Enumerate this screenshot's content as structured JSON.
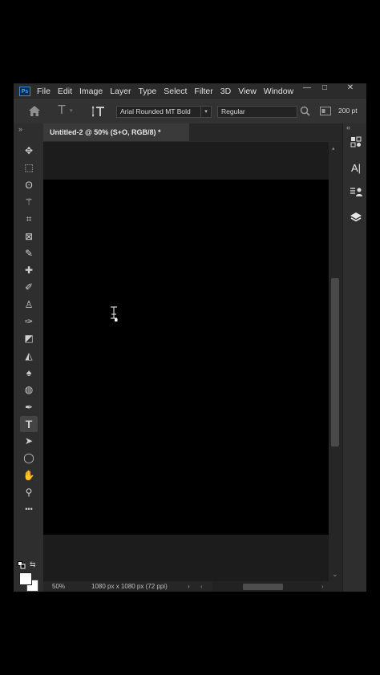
{
  "app": {
    "logo_text": "Ps"
  },
  "menu": [
    "File",
    "Edit",
    "Image",
    "Layer",
    "Type",
    "Select",
    "Filter",
    "3D",
    "View",
    "Window"
  ],
  "window_controls": {
    "minimize": "—",
    "maximize": "□",
    "close": "✕"
  },
  "options_bar": {
    "font_family": "Arial Rounded MT Bold",
    "font_style": "Regular",
    "font_size": "200 pt"
  },
  "document_tab": {
    "title": "Untitled-2 @ 50% (S+O, RGB/8) *"
  },
  "status_bar": {
    "zoom": "50%",
    "doc_info": "1080 px x 1080 px (72 ppi)"
  },
  "toolbar": {
    "collapse": "»",
    "tools": [
      {
        "name": "move-tool-icon",
        "glyph": "✥"
      },
      {
        "name": "marquee-tool-icon",
        "glyph": "⬚"
      },
      {
        "name": "lasso-tool-icon",
        "glyph": "ʘ"
      },
      {
        "name": "magic-wand-tool-icon",
        "glyph": "⚚"
      },
      {
        "name": "crop-tool-icon",
        "glyph": "⌗"
      },
      {
        "name": "frame-tool-icon",
        "glyph": "⊠"
      },
      {
        "name": "eyedropper-tool-icon",
        "glyph": "✎"
      },
      {
        "name": "healing-brush-tool-icon",
        "glyph": "✚"
      },
      {
        "name": "brush-tool-icon",
        "glyph": "✐"
      },
      {
        "name": "clone-stamp-tool-icon",
        "glyph": "♙"
      },
      {
        "name": "history-brush-tool-icon",
        "glyph": "✑"
      },
      {
        "name": "eraser-tool-icon",
        "glyph": "◩"
      },
      {
        "name": "paint-bucket-tool-icon",
        "glyph": "◭"
      },
      {
        "name": "blur-tool-icon",
        "glyph": "♠"
      },
      {
        "name": "dodge-tool-icon",
        "glyph": "◍"
      },
      {
        "name": "pen-tool-icon",
        "glyph": "✒"
      },
      {
        "name": "type-tool-icon",
        "glyph": "T"
      },
      {
        "name": "path-selection-tool-icon",
        "glyph": "➤"
      },
      {
        "name": "ellipse-tool-icon",
        "glyph": "◯"
      },
      {
        "name": "hand-tool-icon",
        "glyph": "✋"
      },
      {
        "name": "zoom-tool-icon",
        "glyph": "⚲"
      },
      {
        "name": "more-tools-icon",
        "glyph": "•••"
      }
    ]
  },
  "colors": {
    "foreground": "#ffffff",
    "background": "#ffffff",
    "accent": "#31a8ff"
  }
}
